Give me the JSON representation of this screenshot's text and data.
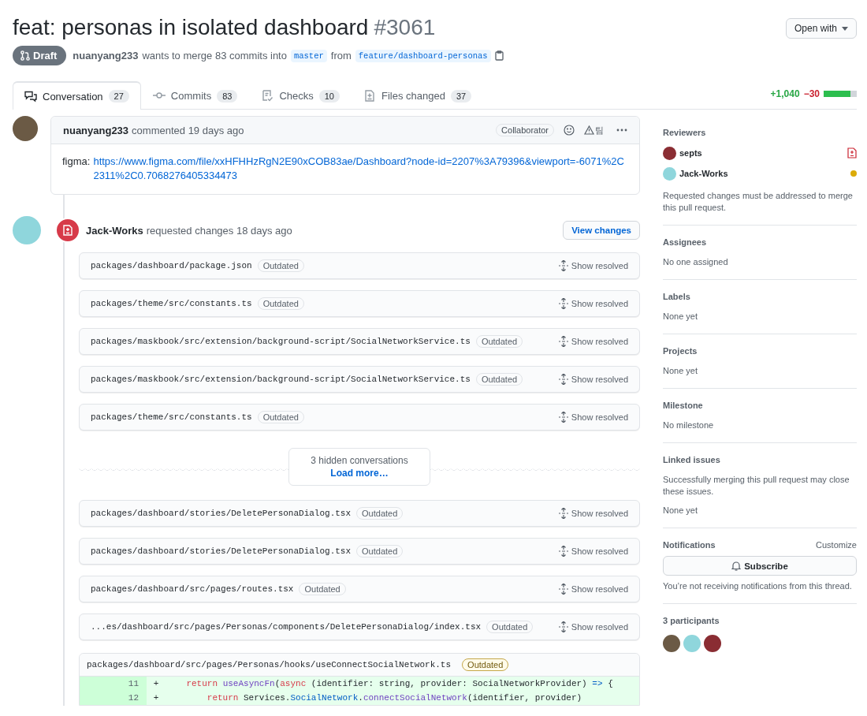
{
  "header": {
    "title": "feat: personas in isolated dashboard",
    "number": "#3061",
    "open_with": "Open with",
    "state": "Draft",
    "author": "nuanyang233",
    "merge_text": "wants to merge 83 commits into",
    "base": "master",
    "from_text": "from",
    "head": "feature/dashboard-personas"
  },
  "tabs": [
    {
      "label": "Conversation",
      "count": "27",
      "selected": true
    },
    {
      "label": "Commits",
      "count": "83",
      "selected": false
    },
    {
      "label": "Checks",
      "count": "10",
      "selected": false
    },
    {
      "label": "Files changed",
      "count": "37",
      "selected": false
    }
  ],
  "diffstat": {
    "additions": "+1,040",
    "deletions": "−30",
    "level": 0.8
  },
  "comment": {
    "author": "nuanyang233",
    "action": "commented 19 days ago",
    "role": "Collaborator",
    "extension_label": "팀",
    "prefix": "figma:",
    "link": "https://www.figma.com/file/xxHFHHzRgN2E90xCOB83ae/Dashboard?node-id=2207%3A79396&viewport=-6071%2C2311%2C0.7068276405334473"
  },
  "review": {
    "author": "Jack-Works",
    "action": "requested changes 18 days ago",
    "button": "View changes"
  },
  "threads": [
    {
      "kind": "file",
      "path": "packages/dashboard/package.json",
      "badge": "Outdated",
      "action": "Show resolved"
    },
    {
      "kind": "file",
      "path": "packages/theme/src/constants.ts",
      "badge": "Outdated",
      "action": "Show resolved"
    },
    {
      "kind": "file",
      "path": "packages/maskbook/src/extension/background-script/SocialNetworkService.ts",
      "badge": "Outdated",
      "action": "Show resolved"
    },
    {
      "kind": "file",
      "path": "packages/maskbook/src/extension/background-script/SocialNetworkService.ts",
      "badge": "Outdated",
      "action": "Show resolved"
    },
    {
      "kind": "file",
      "path": "packages/theme/src/constants.ts",
      "badge": "Outdated",
      "action": "Show resolved"
    },
    {
      "kind": "hidden",
      "text": "3 hidden conversations",
      "link": "Load more…"
    },
    {
      "kind": "file",
      "path": "packages/dashboard/stories/DeletePersonaDialog.tsx",
      "badge": "Outdated",
      "action": "Show resolved"
    },
    {
      "kind": "file",
      "path": "packages/dashboard/stories/DeletePersonaDialog.tsx",
      "badge": "Outdated",
      "action": "Show resolved"
    },
    {
      "kind": "file",
      "path": "packages/dashboard/src/pages/routes.tsx",
      "badge": "Outdated",
      "action": "Show resolved"
    },
    {
      "kind": "file",
      "path": "...es/dashboard/src/pages/Personas/components/DeletePersonaDialog/index.tsx",
      "badge": "Outdated",
      "action": "Show resolved"
    },
    {
      "kind": "code",
      "path": "packages/dashboard/src/pages/Personas/hooks/useConnectSocialNetwork.ts",
      "badge": "Outdated",
      "lines": [
        {
          "number": "11",
          "sign": "+",
          "tokens": [
            {
              "kind": "keyword",
              "text": "    return "
            },
            {
              "kind": "entity",
              "text": "useAsyncFn"
            },
            {
              "kind": "plain",
              "text": "("
            },
            {
              "kind": "keyword",
              "text": "async"
            },
            {
              "kind": "plain",
              "text": " (identifier: string, provider: SocialNetworkProvider) "
            },
            {
              "kind": "constant",
              "text": "=>"
            },
            {
              "kind": "plain",
              "text": " {"
            }
          ]
        },
        {
          "number": "12",
          "sign": "+",
          "tokens": [
            {
              "kind": "keyword",
              "text": "        return"
            },
            {
              "kind": "plain",
              "text": " Services."
            },
            {
              "kind": "constant",
              "text": "SocialNetwork"
            },
            {
              "kind": "plain",
              "text": "."
            },
            {
              "kind": "entity",
              "text": "connectSocialNetwork"
            },
            {
              "kind": "plain",
              "text": "(identifier, provider)"
            }
          ]
        }
      ]
    }
  ],
  "sidebar": {
    "reviewers": {
      "heading": "Reviewers",
      "items": [
        {
          "name": "septs",
          "changes_requested": true
        },
        {
          "name": "Jack-Works",
          "changes_requested": false
        }
      ],
      "note": "Requested changes must be addressed to merge this pull request."
    },
    "sections": [
      {
        "heading": "Assignees",
        "value": "No one assigned"
      },
      {
        "heading": "Labels",
        "value": "None yet"
      },
      {
        "heading": "Projects",
        "value": "None yet"
      },
      {
        "heading": "Milestone",
        "value": "No milestone"
      },
      {
        "heading": "Linked issues",
        "note": "Successfully merging this pull request may close these issues.",
        "value": "None yet"
      }
    ],
    "notifications": {
      "heading": "Notifications",
      "customize": "Customize",
      "button": "Subscribe",
      "note": "You’re not receiving notifications from this thread."
    },
    "participants": {
      "heading": "3 participants"
    }
  }
}
